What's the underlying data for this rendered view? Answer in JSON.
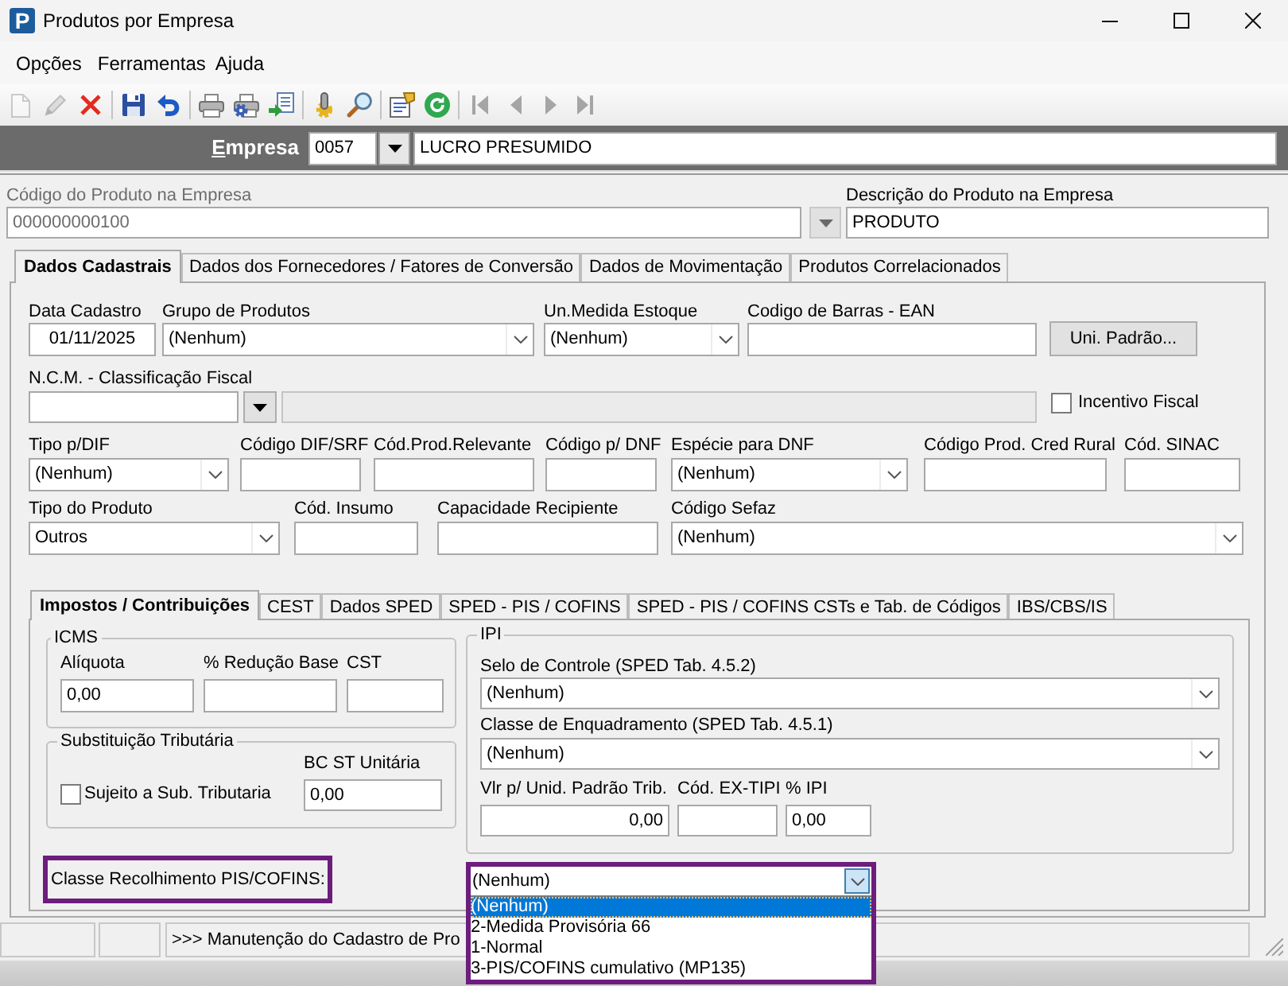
{
  "window": {
    "logo": "P",
    "title": "Produtos por Empresa"
  },
  "menu": [
    {
      "label": "Opções"
    },
    {
      "label": "Ferramentas"
    },
    {
      "label": "Ajuda"
    }
  ],
  "toolbar": [
    {
      "kind": "new",
      "disabled": true
    },
    {
      "kind": "edit",
      "disabled": true
    },
    {
      "kind": "delete",
      "disabled": false
    },
    {
      "kind": "separator"
    },
    {
      "kind": "save",
      "disabled": false
    },
    {
      "kind": "undo",
      "disabled": false
    },
    {
      "kind": "separator"
    },
    {
      "kind": "print",
      "disabled": false
    },
    {
      "kind": "print_setup",
      "disabled": false
    },
    {
      "kind": "export",
      "disabled": false
    },
    {
      "kind": "separator"
    },
    {
      "kind": "tools",
      "disabled": false
    },
    {
      "kind": "search",
      "disabled": false
    },
    {
      "kind": "separator"
    },
    {
      "kind": "properties",
      "disabled": false
    },
    {
      "kind": "refresh",
      "disabled": false
    },
    {
      "kind": "separator"
    },
    {
      "kind": "first",
      "disabled": true
    },
    {
      "kind": "previous",
      "disabled": true
    },
    {
      "kind": "next",
      "disabled": true
    },
    {
      "kind": "last",
      "disabled": true
    }
  ],
  "empresa": {
    "label": "Empresa",
    "code": "0057",
    "name": "LUCRO PRESUMIDO"
  },
  "produto": {
    "code": {
      "label": "Código do Produto na Empresa",
      "value": "000000000100",
      "disabled": true
    },
    "description": {
      "label": "Descrição do Produto na Empresa",
      "value": "PRODUTO"
    }
  },
  "tabs": [
    {
      "label": "Dados Cadastrais",
      "selected": true
    },
    {
      "label": "Dados dos Fornecedores / Fatores de Conversão",
      "selected": false
    },
    {
      "label": "Dados de Movimentação",
      "selected": false
    },
    {
      "label": "Produtos Correlacionados",
      "selected": false
    }
  ],
  "cadastro": {
    "lines": [
      {
        "fields": [
          {
            "kind": "text",
            "label": "Data Cadastro",
            "value": "01/11/2025"
          },
          {
            "kind": "combo",
            "label": "Grupo de Produtos",
            "value": "(Nenhum)"
          },
          {
            "kind": "combo",
            "label": "Un.Medida Estoque",
            "value": "(Nenhum)"
          },
          {
            "kind": "text",
            "label": "Codigo de Barras - EAN"
          },
          {
            "kind": "button",
            "label": "Uni. Padrão..."
          }
        ]
      },
      {
        "fields": [
          {
            "kind": "lookup",
            "label": "N.C.M. - Classificação Fiscal"
          },
          {
            "kind": "checkbox",
            "label": "Incentivo Fiscal",
            "checked": false
          }
        ]
      },
      {
        "fields": [
          {
            "kind": "combo",
            "label": "Tipo p/DIF",
            "value": "(Nenhum)"
          },
          {
            "kind": "text",
            "label": "Código DIF/SRF"
          },
          {
            "kind": "text",
            "label": "Cód.Prod.Relevante"
          },
          {
            "kind": "text",
            "label": "Código p/ DNF"
          },
          {
            "kind": "combo",
            "label": "Espécie para DNF",
            "value": "(Nenhum)"
          },
          {
            "kind": "text",
            "label": "Código Prod. Cred Rural"
          },
          {
            "kind": "text",
            "label": "Cód. SINAC"
          }
        ]
      },
      {
        "fields": [
          {
            "kind": "combo",
            "label": "Tipo do Produto",
            "value": "Outros"
          },
          {
            "kind": "text",
            "label": "Cód. Insumo"
          },
          {
            "kind": "text",
            "label": "Capacidade Recipiente"
          },
          {
            "kind": "combo",
            "label": "Código Sefaz",
            "value": "(Nenhum)"
          }
        ]
      }
    ]
  },
  "subtabs": [
    {
      "label": "Impostos / Contribuições",
      "selected": true
    },
    {
      "label": "CEST",
      "selected": false
    },
    {
      "label": "Dados SPED",
      "selected": false
    },
    {
      "label": "SPED - PIS / COFINS",
      "selected": false
    },
    {
      "label": "SPED - PIS / COFINS CSTs e Tab. de Códigos",
      "selected": false
    },
    {
      "label": "IBS/CBS/IS",
      "selected": false
    }
  ],
  "icms": {
    "title": "ICMS",
    "fields": [
      {
        "label": "Alíquota",
        "value": "0,00"
      },
      {
        "label": "% Redução Base"
      },
      {
        "label": "CST"
      }
    ]
  },
  "substituicao": {
    "title": "Substituição Tributária",
    "checkbox": {
      "label": "Sujeito a Sub. Tributaria",
      "checked": false
    },
    "field": {
      "label": "BC ST Unitária",
      "value": "0,00"
    }
  },
  "ipi": {
    "title": "IPI",
    "combos": [
      {
        "label": "Selo de Controle (SPED Tab. 4.5.2)",
        "value": "(Nenhum)"
      },
      {
        "label": "Classe de Enquadramento (SPED Tab. 4.5.1)",
        "value": "(Nenhum)"
      }
    ],
    "fields": [
      {
        "label": "Vlr p/ Unid. Padrão Trib.",
        "value": "0,00"
      },
      {
        "label": "Cód. EX-TIPI"
      },
      {
        "label": "% IPI",
        "value": "0,00"
      }
    ]
  },
  "pis_cofins": {
    "label": "Classe Recolhimento PIS/COFINS:",
    "value": "(Nenhum)",
    "highlighted": true,
    "expanded": true,
    "options": [
      {
        "label": "(Nenhum)",
        "selected": true
      },
      {
        "label": "2-Medida Provisória 66",
        "selected": false
      },
      {
        "label": "1-Normal",
        "selected": false
      },
      {
        "label": "3-PIS/COFINS cumulativo (MP135)",
        "selected": false
      }
    ]
  },
  "status_bar": {
    "message": ">>> Manutenção do Cadastro de Pro"
  }
}
